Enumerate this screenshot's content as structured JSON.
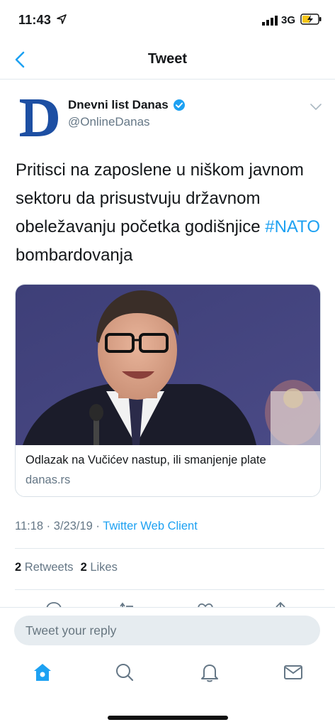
{
  "status_bar": {
    "time": "11:43",
    "network": "3G"
  },
  "nav": {
    "title": "Tweet"
  },
  "tweet": {
    "author_name": "Dnevni list Danas",
    "author_handle": "@OnlineDanas",
    "text_before": "Pritisci na zaposlene u niškom javnom sektoru da prisustvuju državnom obeležavanju početka godišnjice ",
    "hashtag": "#NATO",
    "text_after": " bombardovanja",
    "card": {
      "title": "Odlazak na Vučićev nastup, ili smanjenje plate",
      "domain": "danas.rs"
    },
    "time": "11:18",
    "date": "3/23/19",
    "source": "Twitter Web Client",
    "retweets_count": "2",
    "retweets_label": "Retweets",
    "likes_count": "2",
    "likes_label": "Likes"
  },
  "reply": {
    "placeholder": "Tweet your reply"
  },
  "colors": {
    "accent": "#1da1f2",
    "secondary_text": "#657786",
    "brand_blue": "#1d4fa3"
  },
  "icons": {
    "tabs": [
      "home-icon",
      "search-icon",
      "notifications-icon",
      "messages-icon"
    ],
    "actions": [
      "reply-icon",
      "retweet-icon",
      "like-icon",
      "share-icon"
    ]
  }
}
